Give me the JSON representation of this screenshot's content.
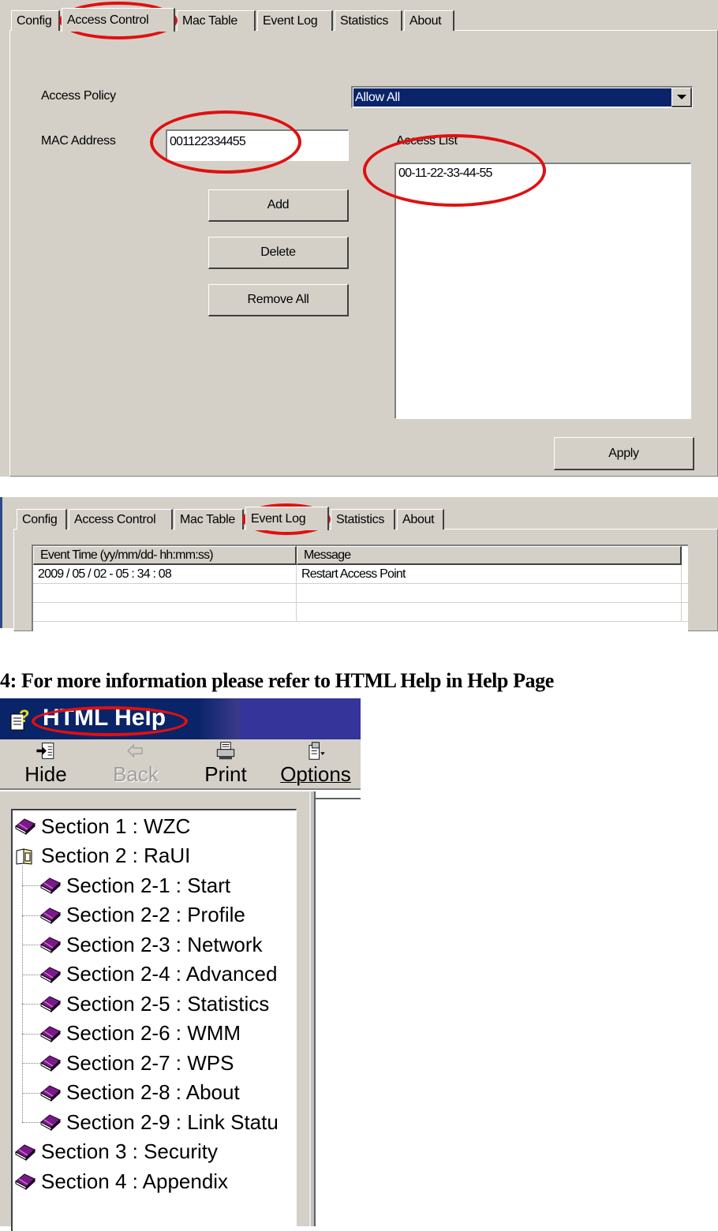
{
  "access_control_panel": {
    "tabs": [
      {
        "label": "Config",
        "active": false
      },
      {
        "label": "Access Control",
        "active": true
      },
      {
        "label": "Mac Table",
        "active": false
      },
      {
        "label": "Event Log",
        "active": false
      },
      {
        "label": "Statistics",
        "active": false
      },
      {
        "label": "About",
        "active": false
      }
    ],
    "access_policy_label": "Access Policy",
    "access_policy_value": "Allow All",
    "mac_address_label": "MAC Address",
    "mac_address_value": "001122334455",
    "access_list_label": "Access List",
    "access_list_items": [
      "00-11-22-33-44-55"
    ],
    "buttons": {
      "add": "Add",
      "delete": "Delete",
      "remove_all": "Remove All",
      "apply": "Apply"
    }
  },
  "event_log_panel": {
    "tabs": [
      {
        "label": "Config",
        "active": false
      },
      {
        "label": "Access Control",
        "active": false
      },
      {
        "label": "Mac Table",
        "active": false
      },
      {
        "label": "Event Log",
        "active": true
      },
      {
        "label": "Statistics",
        "active": false
      },
      {
        "label": "About",
        "active": false
      }
    ],
    "columns": [
      "Event Time (yy/mm/dd- hh:mm:ss)",
      "Message"
    ],
    "rows": [
      [
        "2009 / 05 / 02 - 05 : 34 : 08",
        "Restart Access Point"
      ],
      [
        "",
        ""
      ],
      [
        "",
        ""
      ]
    ]
  },
  "caption": "4: For more information please refer to HTML Help in Help Page",
  "html_help": {
    "title": "HTML Help",
    "toolbar": [
      {
        "label": "Hide",
        "icon": "hide-pane-icon",
        "enabled": true
      },
      {
        "label": "Back",
        "icon": "back-arrow-icon",
        "enabled": false
      },
      {
        "label": "Print",
        "icon": "printer-icon",
        "enabled": true
      },
      {
        "label": "Options",
        "icon": "options-icon",
        "enabled": true
      }
    ],
    "tree": [
      {
        "label": "Section 1 : WZC",
        "level": 0,
        "icon": "closed-book-icon"
      },
      {
        "label": "Section 2 : RaUI",
        "level": 0,
        "icon": "open-book-icon"
      },
      {
        "label": "Section 2-1 : Start",
        "level": 1,
        "icon": "closed-book-icon"
      },
      {
        "label": "Section 2-2 : Profile",
        "level": 1,
        "icon": "closed-book-icon"
      },
      {
        "label": "Section 2-3 : Network",
        "level": 1,
        "icon": "closed-book-icon"
      },
      {
        "label": "Section 2-4 : Advanced",
        "level": 1,
        "icon": "closed-book-icon"
      },
      {
        "label": "Section 2-5 : Statistics",
        "level": 1,
        "icon": "closed-book-icon"
      },
      {
        "label": "Section 2-6 : WMM",
        "level": 1,
        "icon": "closed-book-icon"
      },
      {
        "label": "Section 2-7 : WPS",
        "level": 1,
        "icon": "closed-book-icon"
      },
      {
        "label": "Section 2-8 : About",
        "level": 1,
        "icon": "closed-book-icon"
      },
      {
        "label": "Section 2-9 : Link Statu",
        "level": 1,
        "icon": "closed-book-icon"
      },
      {
        "label": "Section 3 : Security",
        "level": 0,
        "icon": "closed-book-icon"
      },
      {
        "label": "Section 4 : Appendix",
        "level": 0,
        "icon": "closed-book-icon"
      }
    ]
  },
  "colors": {
    "dialog_face": "#d4d0c8",
    "selection": "#0a246a",
    "highlight_oval": "#e01010",
    "book": "#7a1a8a"
  }
}
